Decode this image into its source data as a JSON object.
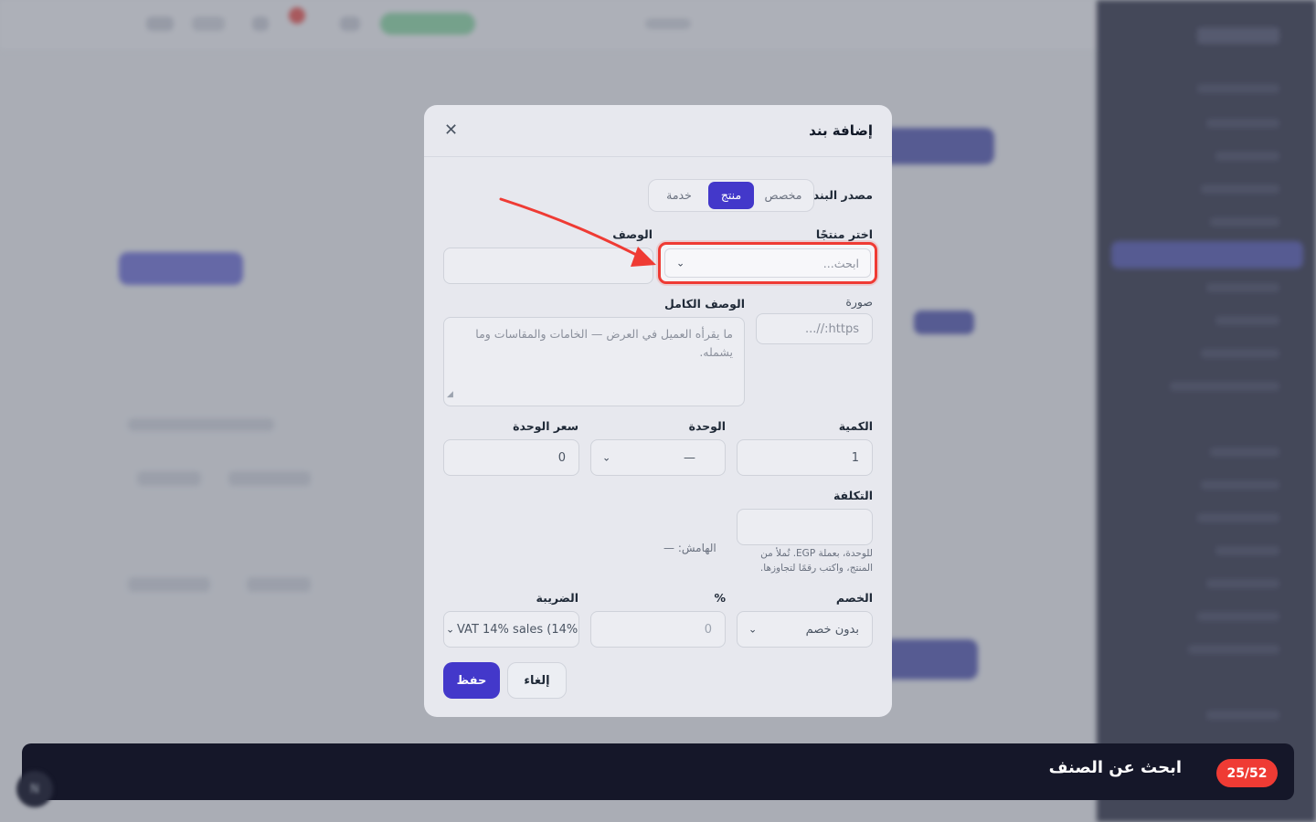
{
  "modal": {
    "title": "إضافة بند",
    "close_icon": "close-icon",
    "source": {
      "label": "مصدر البند",
      "options": [
        "مخصص",
        "منتج",
        "خدمة"
      ],
      "selected": "منتج"
    },
    "product": {
      "label": "اختر منتجًا",
      "placeholder": "ابحث..."
    },
    "description": {
      "label": "الوصف",
      "value": ""
    },
    "image": {
      "label": "صورة",
      "placeholder": "https://..."
    },
    "full_description": {
      "label": "الوصف الكامل",
      "placeholder": "ما يقرأه العميل في العرض — الخامات والمقاسات وما يشمله."
    },
    "quantity": {
      "label": "الكمية",
      "value": "1"
    },
    "unit": {
      "label": "الوحدة",
      "value": "—"
    },
    "unit_price": {
      "label": "سعر الوحدة",
      "value": "0"
    },
    "cost": {
      "label": "التكلفة",
      "value": "",
      "hint": "للوحدة، بعملة EGP. تُملأ من المنتج، واكتب رقمًا لتجاوزها."
    },
    "margin": {
      "label": "الهامش: —"
    },
    "discount": {
      "label": "الخصم",
      "value": "بدون خصم"
    },
    "percent": {
      "label": "%",
      "value": "0"
    },
    "tax": {
      "label": "الضريبة",
      "value": "VAT 14% sales (14%)"
    },
    "save_label": "حفظ",
    "cancel_label": "إلغاء"
  },
  "tour": {
    "title": "ابحث عن الصنف",
    "progress": "25/52",
    "accent": "#ef3b34"
  },
  "colors": {
    "primary": "#4338ca",
    "sidebar": "#12142b",
    "highlight": "#ef3b34"
  }
}
